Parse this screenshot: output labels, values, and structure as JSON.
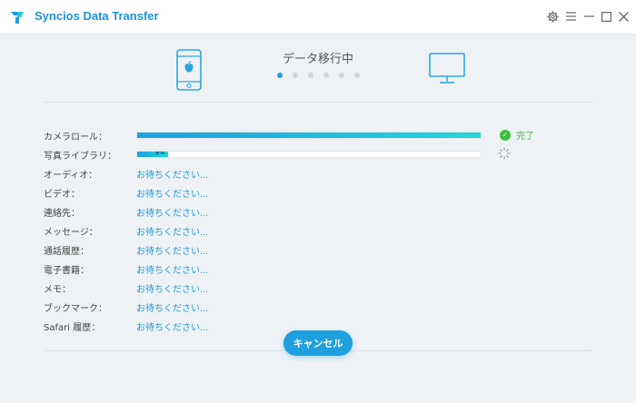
{
  "app": {
    "title": "Syncios Data Transfer"
  },
  "window_controls": {
    "settings_icon": "gear-icon",
    "menu_icon": "hamburger-icon",
    "minimize_icon": "minimize-icon",
    "maximize_icon": "maximize-icon",
    "close_icon": "close-icon"
  },
  "transfer": {
    "status_title": "データ移行中",
    "step_count": 6,
    "active_step": 1,
    "source_device_icon": "iphone-icon",
    "target_device_icon": "monitor-icon"
  },
  "items": [
    {
      "label": "カメラロール：",
      "state": "done",
      "done_text": "完了",
      "progress": 1.0
    },
    {
      "label": "写真ライブラリ：",
      "state": "in_progress",
      "progress": 0.09,
      "progress_text": "9%"
    },
    {
      "label": "オーディオ：",
      "state": "waiting",
      "wait_text": "お待ちください..."
    },
    {
      "label": "ビデオ：",
      "state": "waiting",
      "wait_text": "お待ちください..."
    },
    {
      "label": "連絡先：",
      "state": "waiting",
      "wait_text": "お待ちください..."
    },
    {
      "label": "メッセージ：",
      "state": "waiting",
      "wait_text": "お待ちください..."
    },
    {
      "label": "通話履歴：",
      "state": "waiting",
      "wait_text": "お待ちください..."
    },
    {
      "label": "電子書籍：",
      "state": "waiting",
      "wait_text": "お待ちください..."
    },
    {
      "label": "メモ：",
      "state": "waiting",
      "wait_text": "お待ちください..."
    },
    {
      "label": "ブックマーク：",
      "state": "waiting",
      "wait_text": "お待ちください..."
    },
    {
      "label": "Safari 履歴：",
      "state": "waiting",
      "wait_text": "お待ちください..."
    }
  ],
  "footer": {
    "cancel_label": "キャンセル"
  },
  "colors": {
    "accent": "#1ea0e0",
    "success": "#3bbf3b",
    "brand_title": "#1e90d6"
  }
}
